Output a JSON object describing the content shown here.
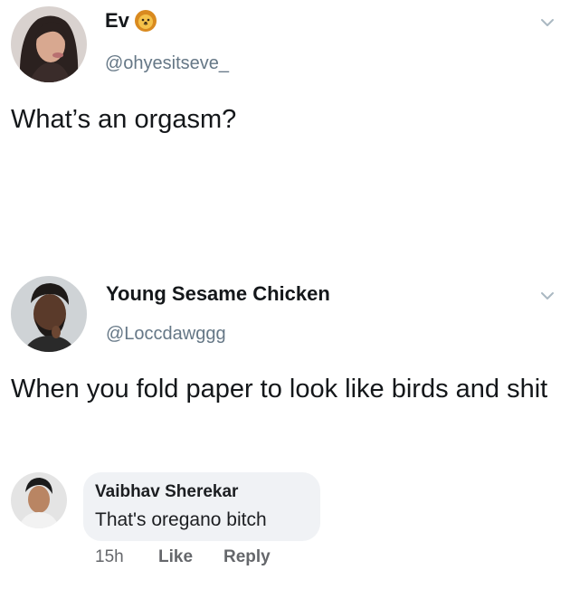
{
  "tweets": [
    {
      "display_name": "Ev",
      "name_emoji": "lion-face-emoji",
      "handle": "@ohyesitseve_",
      "text": "What’s an orgasm?",
      "avatar": "avatar-woman"
    },
    {
      "display_name": "Young Sesame Chicken",
      "handle": "@Loccdawggg",
      "text": "When you fold paper to look like birds and shit",
      "avatar": "avatar-man"
    }
  ],
  "comment": {
    "author": "Vaibhav Sherekar",
    "text": "That's oregano bitch",
    "time": "15h",
    "like_label": "Like",
    "reply_label": "Reply",
    "avatar": "avatar-young-man"
  },
  "icons": {
    "menu": "chevron-down-icon"
  },
  "colors": {
    "text_primary": "#14171a",
    "text_secondary": "#657786",
    "bubble_bg": "#f0f2f5",
    "fb_secondary": "#65676b"
  }
}
